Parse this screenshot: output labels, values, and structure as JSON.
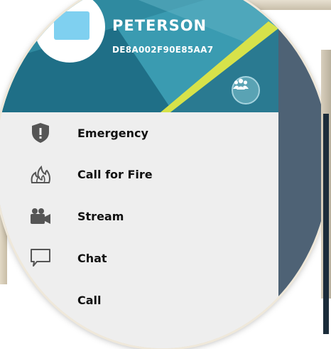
{
  "user": {
    "name": "PETERSON",
    "device_id": "DE8A002F90E85AA7"
  },
  "menu": {
    "items": [
      {
        "label": "Emergency",
        "icon": "shield-exclamation-icon"
      },
      {
        "label": "Call for Fire",
        "icon": "fire-icon"
      },
      {
        "label": "Stream",
        "icon": "video-camera-icon"
      },
      {
        "label": "Chat",
        "icon": "chat-bubble-icon"
      },
      {
        "label": "Call",
        "icon": "phone-icon"
      }
    ]
  },
  "colors": {
    "header_teal": "#2f8aa0",
    "header_dark": "#1e6f86",
    "accent_yellow": "#d7e24a",
    "menu_bg": "#eeeeee",
    "icon_gray": "#555555",
    "map_panel": "#4e6275"
  }
}
